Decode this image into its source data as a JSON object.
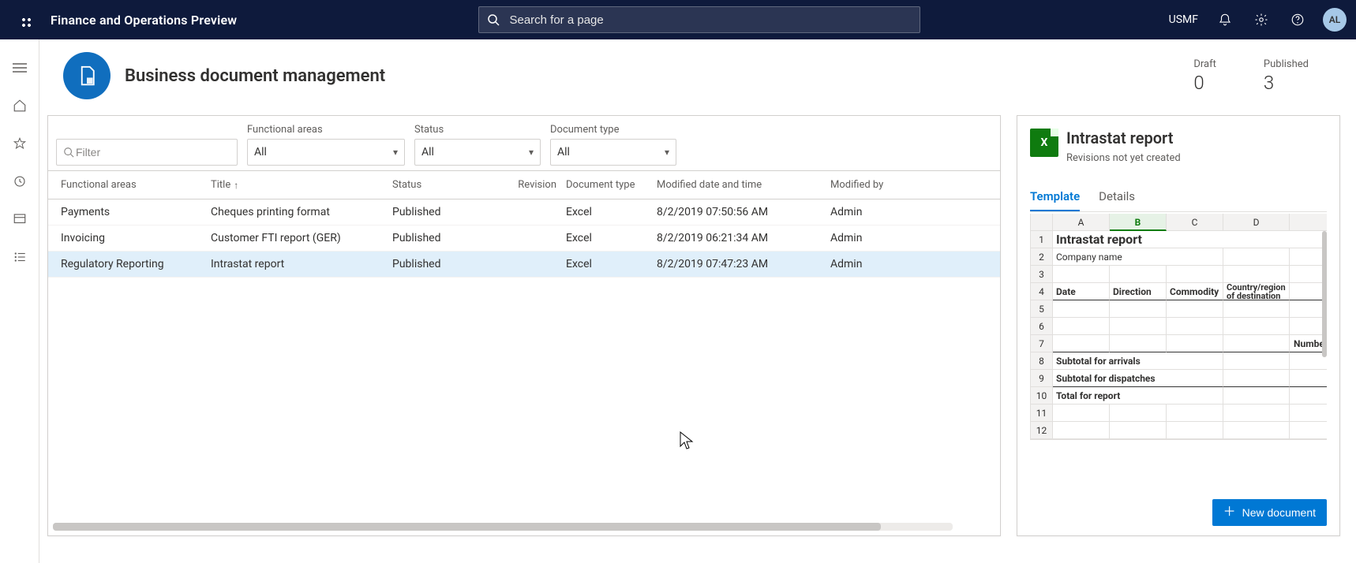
{
  "topbar": {
    "brand": "Finance and Operations Preview",
    "search_placeholder": "Search for a page",
    "company": "USMF",
    "avatar": "AL"
  },
  "page": {
    "title": "Business document management",
    "kpis": [
      {
        "label": "Draft",
        "value": "0"
      },
      {
        "label": "Published",
        "value": "3"
      }
    ]
  },
  "filters": {
    "search_placeholder": "Filter",
    "functional_areas": {
      "label": "Functional areas",
      "value": "All"
    },
    "status": {
      "label": "Status",
      "value": "All"
    },
    "document_type": {
      "label": "Document type",
      "value": "All"
    }
  },
  "columns": {
    "c0": "Functional areas",
    "c1": "Title",
    "c2": "Status",
    "c3": "Revision",
    "c4": "Document type",
    "c5": "Modified date and time",
    "c6": "Modified by"
  },
  "rows": [
    {
      "area": "Payments",
      "title": "Cheques printing format",
      "status": "Published",
      "revision": "",
      "doctype": "Excel",
      "modified": "8/2/2019 07:50:56 AM",
      "by": "Admin",
      "selected": false
    },
    {
      "area": "Invoicing",
      "title": "Customer FTI report (GER)",
      "status": "Published",
      "revision": "",
      "doctype": "Excel",
      "modified": "8/2/2019 06:21:34 AM",
      "by": "Admin",
      "selected": false
    },
    {
      "area": "Regulatory Reporting",
      "title": "Intrastat report",
      "status": "Published",
      "revision": "",
      "doctype": "Excel",
      "modified": "8/2/2019 07:47:23 AM",
      "by": "Admin",
      "selected": true
    }
  ],
  "side": {
    "title": "Intrastat report",
    "subtitle": "Revisions not yet created",
    "tab_template": "Template",
    "tab_details": "Details",
    "new_button": "New document"
  },
  "sheet": {
    "cols": [
      "A",
      "B",
      "C",
      "D"
    ],
    "r1_title": "Intrastat report",
    "r2_a": "Company name",
    "r4_a": "Date",
    "r4_b": "Direction",
    "r4_c": "Commodity",
    "r4_d": "Country/region of destination",
    "r7_d": "Number of lines",
    "r8_a": "Subtotal for arrivals",
    "r9_a": "Subtotal for dispatches",
    "r10_a": "Total for report"
  }
}
